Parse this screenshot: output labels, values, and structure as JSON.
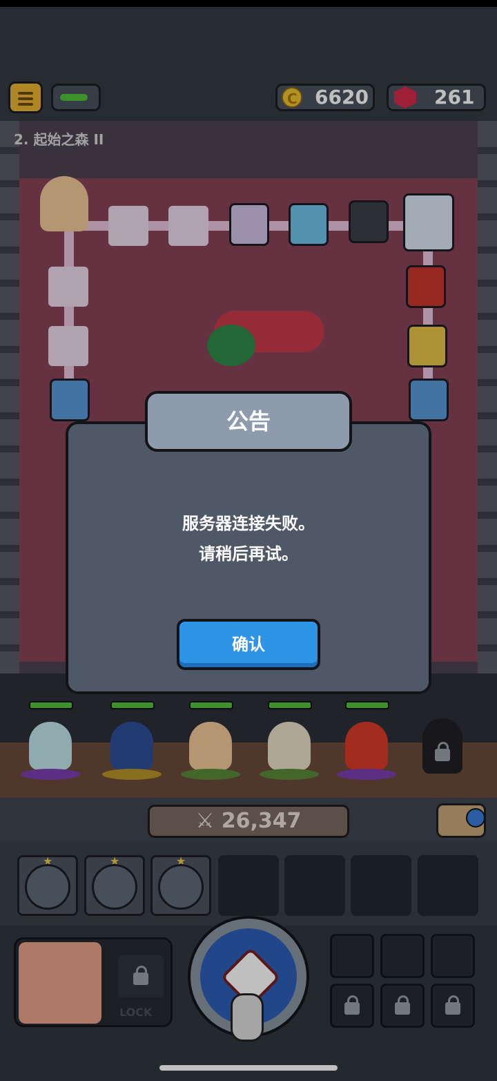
{
  "header": {
    "coins": "6620",
    "gems": "261"
  },
  "stage": {
    "title": "2. 起始之森 II"
  },
  "dialog": {
    "title": "公告",
    "message_line1": "服务器连接失败。",
    "message_line2": "请稍后再试。",
    "confirm_label": "确认"
  },
  "party": {
    "power": "26,347"
  },
  "bottom": {
    "lock_label": "LOCK"
  },
  "colors": {
    "accent_blue": "#2f93e6",
    "coin_gold": "#f1c232",
    "gem_red": "#d52a4a"
  }
}
